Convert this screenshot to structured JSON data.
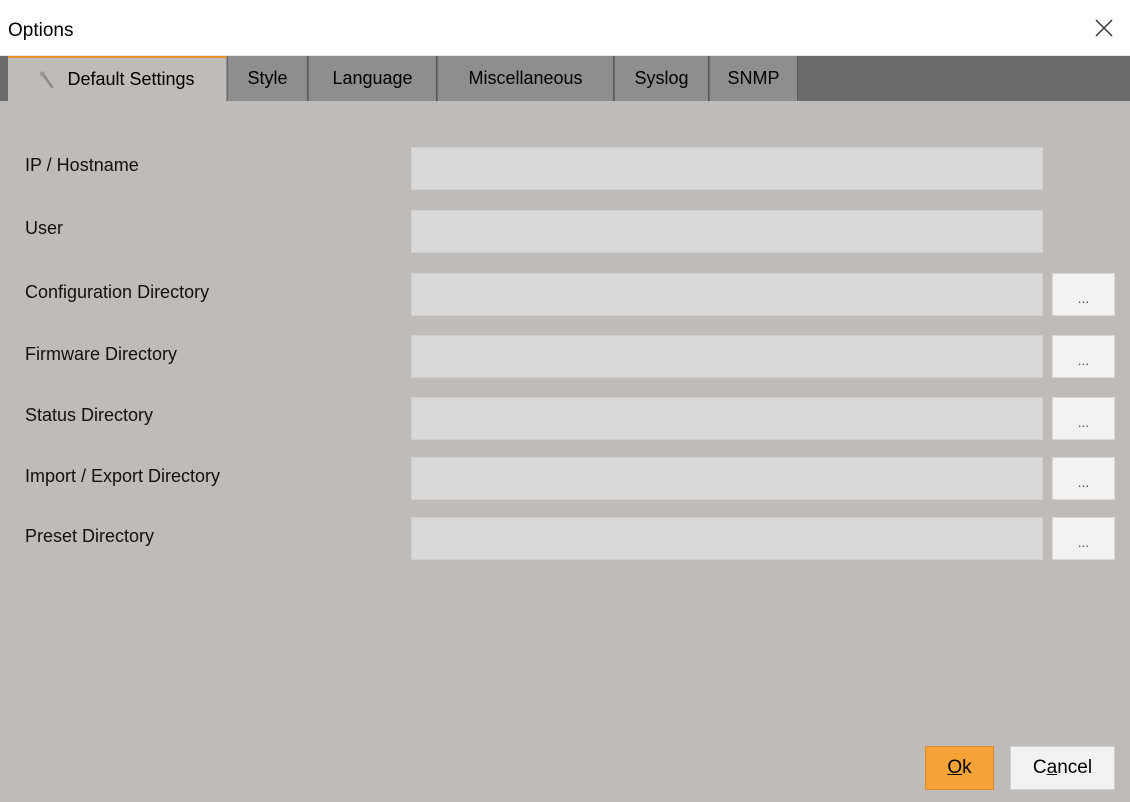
{
  "window": {
    "title": "Options"
  },
  "tabs": [
    {
      "label": "Default Settings"
    },
    {
      "label": "Style"
    },
    {
      "label": "Language"
    },
    {
      "label": "Miscellaneous"
    },
    {
      "label": "Syslog"
    },
    {
      "label": "SNMP"
    }
  ],
  "form": {
    "ip_label": "IP / Hostname",
    "ip_value": "",
    "user_label": "User",
    "user_value": "",
    "config_label": "Configuration Directory",
    "config_value": "",
    "firmware_label": "Firmware Directory",
    "firmware_value": "",
    "status_label": "Status Directory",
    "status_value": "",
    "import_label": "Import / Export Directory",
    "import_value": "",
    "preset_label": "Preset Directory",
    "preset_value": "",
    "browse_label": "..."
  },
  "buttons": {
    "ok_underlined": "O",
    "ok_rest": "k",
    "cancel_prefix": "C",
    "cancel_underlined": "a",
    "cancel_rest": "ncel"
  },
  "colors": {
    "accent": "#e5922d",
    "ok_button": "#f5a337",
    "tabbar_bg": "#6b6b6b",
    "tab_bg": "#8e8e8e",
    "panel_bg": "#bebbb8",
    "field_bg": "#d9d9d9"
  },
  "icons": {
    "tab_default": "wrench-icon",
    "close": "close-icon"
  }
}
